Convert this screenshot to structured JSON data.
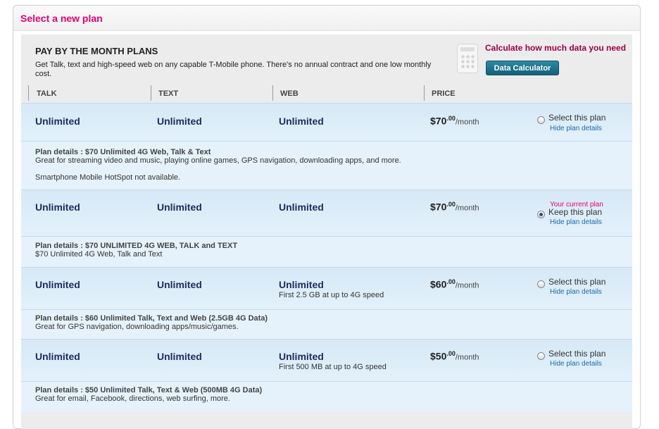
{
  "panel": {
    "title": "Select a new plan"
  },
  "header": {
    "title": "PAY BY THE MONTH PLANS",
    "description": "Get Talk, text and high-speed web on any capable T-Mobile phone. There's no annual contract and one low monthly cost."
  },
  "calculator": {
    "icon": "calculator-icon",
    "title": "Calculate how much data you need",
    "button_label": "Data Calculator"
  },
  "columns": [
    "TALK",
    "TEXT",
    "WEB",
    "PRICE"
  ],
  "plans": [
    {
      "talk": "Unlimited",
      "text": "Unlimited",
      "web": "Unlimited",
      "web_note": "",
      "price_main": "$70",
      "price_cents": ".00",
      "price_period": "/month",
      "select_label": "Select this plan",
      "current_label": "",
      "selected": false,
      "hide_label": "Hide plan details",
      "details_title": "Plan details : $70 Unlimited 4G Web, Talk & Text",
      "details_lines": [
        "Great for streaming video and music, playing online games, GPS navigation, downloading apps, and more.",
        "Smartphone Mobile HotSpot not available."
      ]
    },
    {
      "talk": "Unlimited",
      "text": "Unlimited",
      "web": "Unlimited",
      "web_note": "",
      "price_main": "$70",
      "price_cents": ".00",
      "price_period": "/month",
      "select_label": "Keep this plan",
      "current_label": "Your current plan",
      "selected": true,
      "hide_label": "Hide plan details",
      "details_title": "Plan details : $70 UNLIMITED 4G WEB, TALK and TEXT",
      "details_lines": [
        "$70 Unlimited 4G Web, Talk and Text"
      ]
    },
    {
      "talk": "Unlimited",
      "text": "Unlimited",
      "web": "Unlimited",
      "web_note": "First 2.5 GB at up to 4G speed",
      "price_main": "$60",
      "price_cents": ".00",
      "price_period": "/month",
      "select_label": "Select this plan",
      "current_label": "",
      "selected": false,
      "hide_label": "Hide plan details",
      "details_title": "Plan details : $60 Unlimited Talk, Text and Web (2.5GB 4G Data)",
      "details_lines": [
        "Great for GPS navigation, downloading apps/music/games."
      ]
    },
    {
      "talk": "Unlimited",
      "text": "Unlimited",
      "web": "Unlimited",
      "web_note": "First 500 MB at up to 4G speed",
      "price_main": "$50",
      "price_cents": ".00",
      "price_period": "/month",
      "select_label": "Select this plan",
      "current_label": "",
      "selected": false,
      "hide_label": "Hide plan details",
      "details_title": "Plan details : $50 Unlimited Talk, Text & Web (500MB 4G Data)",
      "details_lines": [
        "Great for email, Facebook, directions, web surfing, more."
      ]
    }
  ]
}
